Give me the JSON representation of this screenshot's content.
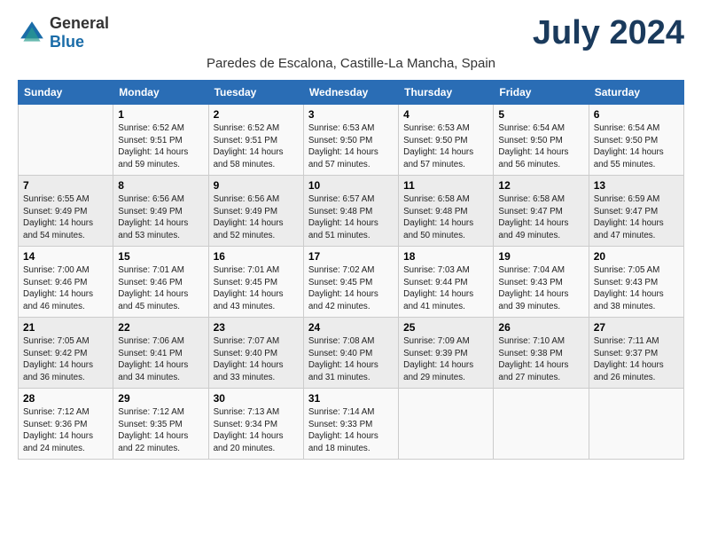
{
  "header": {
    "logo_general": "General",
    "logo_blue": "Blue",
    "month_title": "July 2024",
    "subtitle": "Paredes de Escalona, Castille-La Mancha, Spain"
  },
  "days_of_week": [
    "Sunday",
    "Monday",
    "Tuesday",
    "Wednesday",
    "Thursday",
    "Friday",
    "Saturday"
  ],
  "weeks": [
    [
      {
        "day": "",
        "info": ""
      },
      {
        "day": "1",
        "info": "Sunrise: 6:52 AM\nSunset: 9:51 PM\nDaylight: 14 hours\nand 59 minutes."
      },
      {
        "day": "2",
        "info": "Sunrise: 6:52 AM\nSunset: 9:51 PM\nDaylight: 14 hours\nand 58 minutes."
      },
      {
        "day": "3",
        "info": "Sunrise: 6:53 AM\nSunset: 9:50 PM\nDaylight: 14 hours\nand 57 minutes."
      },
      {
        "day": "4",
        "info": "Sunrise: 6:53 AM\nSunset: 9:50 PM\nDaylight: 14 hours\nand 57 minutes."
      },
      {
        "day": "5",
        "info": "Sunrise: 6:54 AM\nSunset: 9:50 PM\nDaylight: 14 hours\nand 56 minutes."
      },
      {
        "day": "6",
        "info": "Sunrise: 6:54 AM\nSunset: 9:50 PM\nDaylight: 14 hours\nand 55 minutes."
      }
    ],
    [
      {
        "day": "7",
        "info": "Sunrise: 6:55 AM\nSunset: 9:49 PM\nDaylight: 14 hours\nand 54 minutes."
      },
      {
        "day": "8",
        "info": "Sunrise: 6:56 AM\nSunset: 9:49 PM\nDaylight: 14 hours\nand 53 minutes."
      },
      {
        "day": "9",
        "info": "Sunrise: 6:56 AM\nSunset: 9:49 PM\nDaylight: 14 hours\nand 52 minutes."
      },
      {
        "day": "10",
        "info": "Sunrise: 6:57 AM\nSunset: 9:48 PM\nDaylight: 14 hours\nand 51 minutes."
      },
      {
        "day": "11",
        "info": "Sunrise: 6:58 AM\nSunset: 9:48 PM\nDaylight: 14 hours\nand 50 minutes."
      },
      {
        "day": "12",
        "info": "Sunrise: 6:58 AM\nSunset: 9:47 PM\nDaylight: 14 hours\nand 49 minutes."
      },
      {
        "day": "13",
        "info": "Sunrise: 6:59 AM\nSunset: 9:47 PM\nDaylight: 14 hours\nand 47 minutes."
      }
    ],
    [
      {
        "day": "14",
        "info": "Sunrise: 7:00 AM\nSunset: 9:46 PM\nDaylight: 14 hours\nand 46 minutes."
      },
      {
        "day": "15",
        "info": "Sunrise: 7:01 AM\nSunset: 9:46 PM\nDaylight: 14 hours\nand 45 minutes."
      },
      {
        "day": "16",
        "info": "Sunrise: 7:01 AM\nSunset: 9:45 PM\nDaylight: 14 hours\nand 43 minutes."
      },
      {
        "day": "17",
        "info": "Sunrise: 7:02 AM\nSunset: 9:45 PM\nDaylight: 14 hours\nand 42 minutes."
      },
      {
        "day": "18",
        "info": "Sunrise: 7:03 AM\nSunset: 9:44 PM\nDaylight: 14 hours\nand 41 minutes."
      },
      {
        "day": "19",
        "info": "Sunrise: 7:04 AM\nSunset: 9:43 PM\nDaylight: 14 hours\nand 39 minutes."
      },
      {
        "day": "20",
        "info": "Sunrise: 7:05 AM\nSunset: 9:43 PM\nDaylight: 14 hours\nand 38 minutes."
      }
    ],
    [
      {
        "day": "21",
        "info": "Sunrise: 7:05 AM\nSunset: 9:42 PM\nDaylight: 14 hours\nand 36 minutes."
      },
      {
        "day": "22",
        "info": "Sunrise: 7:06 AM\nSunset: 9:41 PM\nDaylight: 14 hours\nand 34 minutes."
      },
      {
        "day": "23",
        "info": "Sunrise: 7:07 AM\nSunset: 9:40 PM\nDaylight: 14 hours\nand 33 minutes."
      },
      {
        "day": "24",
        "info": "Sunrise: 7:08 AM\nSunset: 9:40 PM\nDaylight: 14 hours\nand 31 minutes."
      },
      {
        "day": "25",
        "info": "Sunrise: 7:09 AM\nSunset: 9:39 PM\nDaylight: 14 hours\nand 29 minutes."
      },
      {
        "day": "26",
        "info": "Sunrise: 7:10 AM\nSunset: 9:38 PM\nDaylight: 14 hours\nand 27 minutes."
      },
      {
        "day": "27",
        "info": "Sunrise: 7:11 AM\nSunset: 9:37 PM\nDaylight: 14 hours\nand 26 minutes."
      }
    ],
    [
      {
        "day": "28",
        "info": "Sunrise: 7:12 AM\nSunset: 9:36 PM\nDaylight: 14 hours\nand 24 minutes."
      },
      {
        "day": "29",
        "info": "Sunrise: 7:12 AM\nSunset: 9:35 PM\nDaylight: 14 hours\nand 22 minutes."
      },
      {
        "day": "30",
        "info": "Sunrise: 7:13 AM\nSunset: 9:34 PM\nDaylight: 14 hours\nand 20 minutes."
      },
      {
        "day": "31",
        "info": "Sunrise: 7:14 AM\nSunset: 9:33 PM\nDaylight: 14 hours\nand 18 minutes."
      },
      {
        "day": "",
        "info": ""
      },
      {
        "day": "",
        "info": ""
      },
      {
        "day": "",
        "info": ""
      }
    ]
  ]
}
